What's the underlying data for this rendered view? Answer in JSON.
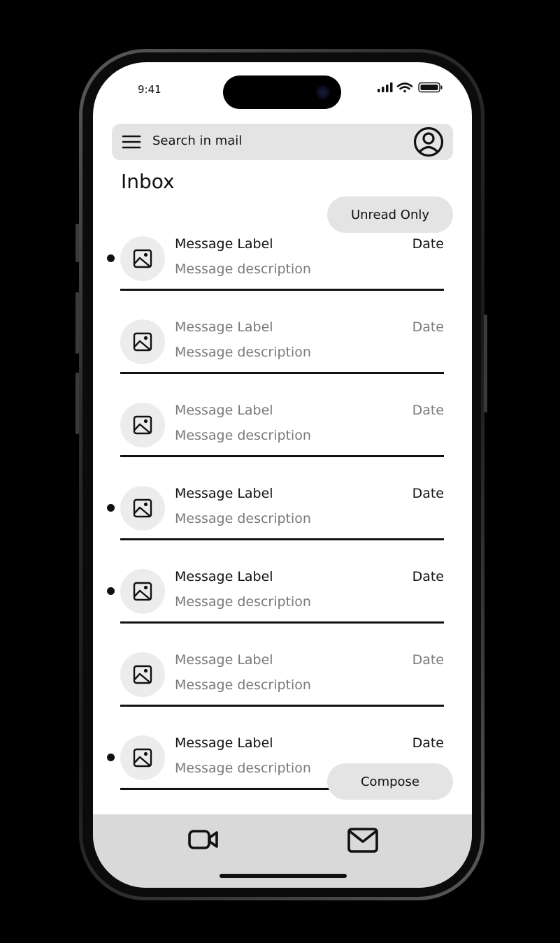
{
  "status": {
    "time": "9:41"
  },
  "search": {
    "placeholder": "Search in mail"
  },
  "inbox": {
    "title": "Inbox"
  },
  "filter": {
    "unread_label": "Unread Only"
  },
  "messages": [
    {
      "label": "Message Label",
      "description": "Message description",
      "date": "Date",
      "unread": true
    },
    {
      "label": "Message Label",
      "description": "Message description",
      "date": "Date",
      "unread": false
    },
    {
      "label": "Message Label",
      "description": "Message description",
      "date": "Date",
      "unread": false
    },
    {
      "label": "Message Label",
      "description": "Message description",
      "date": "Date",
      "unread": true
    },
    {
      "label": "Message Label",
      "description": "Message description",
      "date": "Date",
      "unread": true
    },
    {
      "label": "Message Label",
      "description": "Message description",
      "date": "Date",
      "unread": false
    },
    {
      "label": "Message Label",
      "description": "Message description",
      "date": "Date",
      "unread": true
    }
  ],
  "compose": {
    "label": "Compose"
  },
  "nav": {
    "items": [
      {
        "icon": "video-camera-icon"
      },
      {
        "icon": "mail-icon"
      }
    ]
  }
}
